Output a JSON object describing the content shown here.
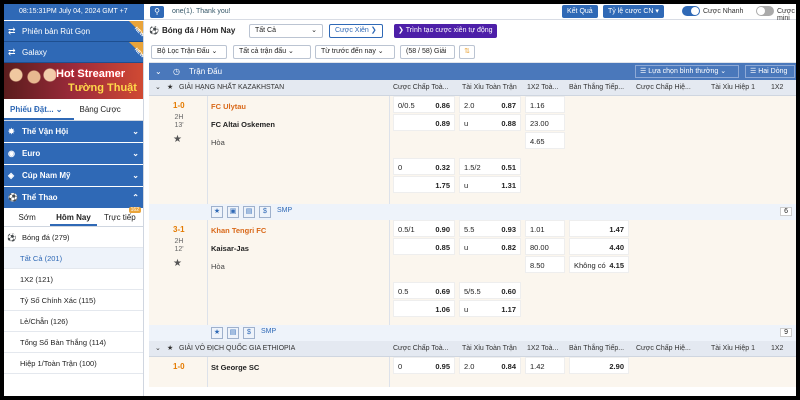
{
  "topbar": {
    "clock": "08:15:31PM July 04, 2024 GMT +7",
    "ticker": "one(1). Thank you!",
    "results": "Kết Quả",
    "odds": "Tỷ lệ cược CN",
    "fast": "Cược Nhanh",
    "mini": "Cược mini"
  },
  "sidebar": {
    "promo1": "Phiên bản Rút Gọn",
    "promo2": "Galaxy",
    "new_badge": "NEW",
    "banner": {
      "line1": "Hot Streamer",
      "line2": "Tường Thuật"
    },
    "ticket_tabs": [
      "Phiếu Đặt...",
      "Bảng Cược"
    ],
    "sports": [
      "Thế Vận Hội",
      "Euro",
      "Cúp Nam Mỹ",
      "Thể Thao"
    ],
    "time_tabs": [
      "Sớm",
      "Hôm Nay",
      "Trực tiếp"
    ],
    "live_count": "162",
    "menu": [
      {
        "label": "Bóng đá (279)"
      },
      {
        "label": "Tất Cả (201)"
      },
      {
        "label": "1X2 (121)"
      },
      {
        "label": "Tỷ Số Chính Xác (115)"
      },
      {
        "label": "Lẻ/Chẵn (126)"
      },
      {
        "label": "Tổng Số Bàn Thắng (114)"
      },
      {
        "label": "Hiệp 1/Toàn Trận (100)"
      }
    ]
  },
  "main": {
    "breadcrumb": "Bóng đá / Hôm Nay",
    "filter_all": "Tất Cả",
    "btn_parlay": "Cược Xiên",
    "btn_parlay_builder": "Trình tạo cược xiên tự động",
    "filters": [
      "Bộ Lọc Trận Đấu",
      "Tất cả trận đấu",
      "Từ trước đến nay",
      "(58 / 58) Giải"
    ],
    "section": "Trận Đấu",
    "sort_mode": "Lựa chọn bình thường",
    "line_mode": "Hai Dòng",
    "columns": [
      "Cược Chấp Toà...",
      "Tài Xỉu Toàn Trận",
      "1X2 Toà...",
      "Bàn Thắng Tiếp...",
      "Cược Chấp Hiệ...",
      "Tài Xỉu Hiệp 1",
      "1X2 Hiệ..."
    ],
    "smp": "SMP",
    "leagues": [
      {
        "name": "GIẢI HẠNG NHẤT KAZAKHSTAN",
        "matches": [
          {
            "score": "1-0",
            "half": "2H",
            "minute": "13'",
            "home": "FC Ulytau",
            "away": "FC Altai Oskemen",
            "draw": "Hòa",
            "more": "6",
            "rows": [
              {
                "hc": "0/0.5",
                "hco": "0.86",
                "ou": "2.0",
                "ouo": "0.87",
                "x1": "1.16"
              },
              {
                "hc": "",
                "hco": "0.89",
                "ou": "u",
                "ouo": "0.88",
                "x1": "23.00"
              },
              {
                "hc": "",
                "hco": "",
                "ou": "",
                "ouo": "",
                "x1": "4.65"
              },
              {
                "hc": "0",
                "hco": "0.32",
                "ou": "1.5/2",
                "ouo": "0.51",
                "x1": ""
              },
              {
                "hc": "",
                "hco": "1.75",
                "ou": "u",
                "ouo": "1.31",
                "x1": ""
              }
            ]
          },
          {
            "score": "3-1",
            "half": "2H",
            "minute": "12'",
            "home": "Khan Tengri FC",
            "away": "Kaisar-Jas",
            "draw": "Hòa",
            "more": "9",
            "no_goal": "Không có",
            "rows": [
              {
                "hc": "0.5/1",
                "hco": "0.90",
                "ou": "5.5",
                "ouo": "0.93",
                "x1": "1.01",
                "ng": "1.47"
              },
              {
                "hc": "",
                "hco": "0.85",
                "ou": "u",
                "ouo": "0.82",
                "x1": "80.00",
                "ng": "4.40"
              },
              {
                "hc": "",
                "hco": "",
                "ou": "",
                "ouo": "",
                "x1": "8.50",
                "ng": "4.15"
              },
              {
                "hc": "0.5",
                "hco": "0.69",
                "ou": "5/5.5",
                "ouo": "0.60",
                "x1": ""
              },
              {
                "hc": "",
                "hco": "1.06",
                "ou": "u",
                "ouo": "1.17",
                "x1": ""
              }
            ]
          }
        ]
      },
      {
        "name": "GIẢI VÔ ĐỊCH QUỐC GIA ETHIOPIA",
        "matches": [
          {
            "score": "1-0",
            "home": "St George SC",
            "rows": [
              {
                "hc": "0",
                "hco": "0.95",
                "ou": "2.0",
                "ouo": "0.84",
                "x1": "1.42",
                "ng": "2.90"
              }
            ]
          }
        ]
      }
    ]
  }
}
